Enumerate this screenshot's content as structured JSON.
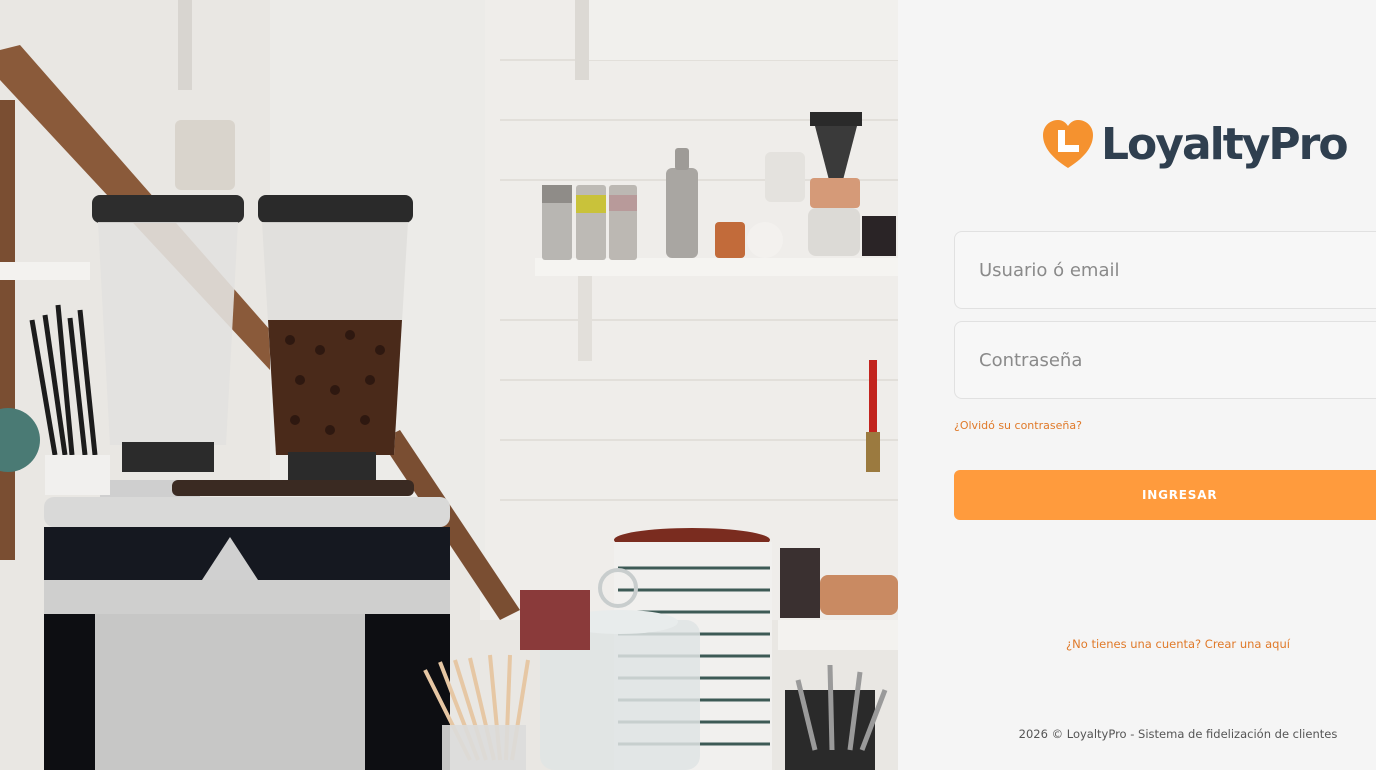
{
  "brand": {
    "name": "LoyaltyPro",
    "logo_icon": "heart-L-icon",
    "accent_color": "#ff9b3d",
    "text_color": "#2f3f4f"
  },
  "photo": {
    "icon": "coffee-shop-photo"
  },
  "login": {
    "username_placeholder": "Usuario ó email",
    "password_placeholder": "Contraseña",
    "forgot_link": "¿Olvidó su contraseña?",
    "submit_label": "INGRESAR",
    "signup_text": "¿No tienes una cuenta? Crear una aquí"
  },
  "footer": {
    "text": "2026 © LoyaltyPro - Sistema de fidelización de clientes"
  }
}
